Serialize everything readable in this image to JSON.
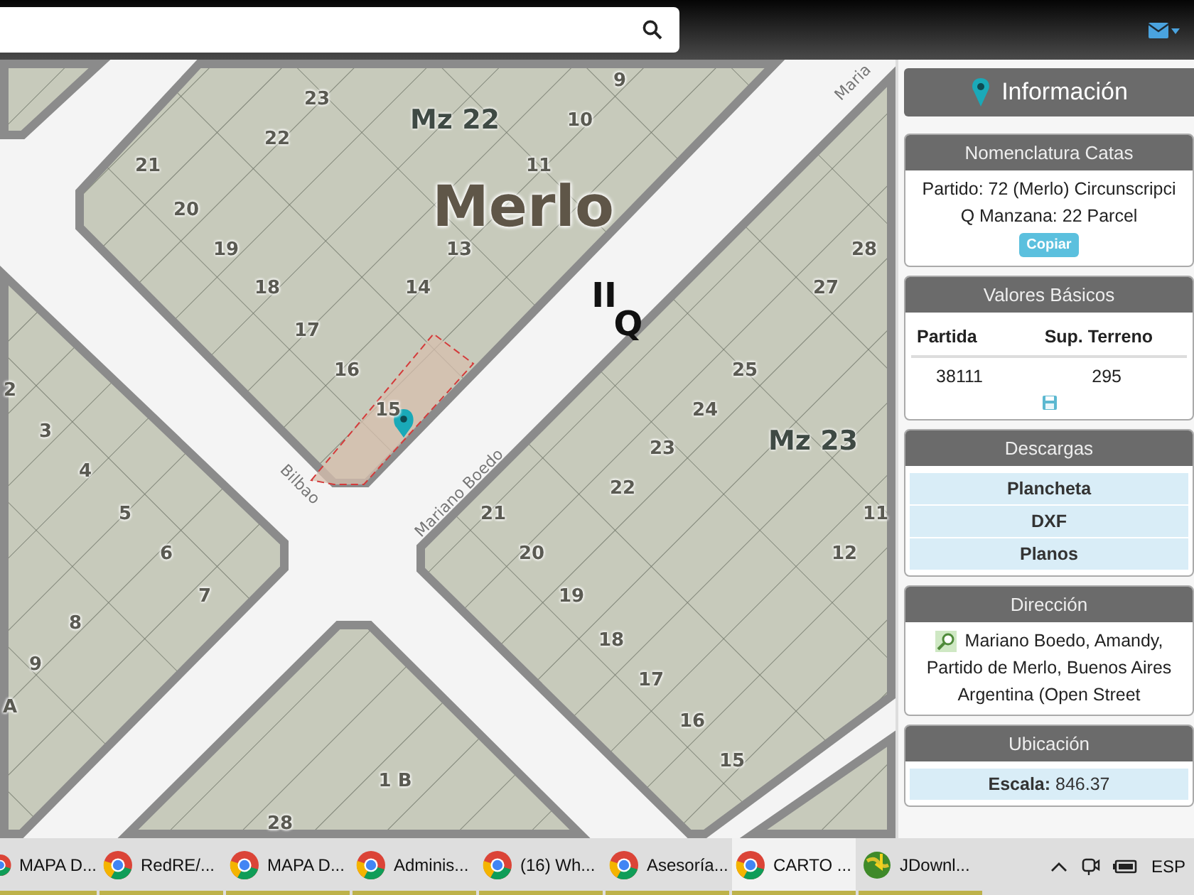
{
  "map": {
    "block_labels": [
      {
        "kind": "street",
        "text": "Maria"
      },
      {
        "kind": "block",
        "text": "Mz 22"
      },
      {
        "kind": "locality",
        "text": "Merlo"
      },
      {
        "kind": "section",
        "text": "II"
      },
      {
        "kind": "section",
        "text": "Q"
      },
      {
        "kind": "block",
        "text": "Mz 23"
      },
      {
        "kind": "street",
        "text": "Bilbao"
      },
      {
        "kind": "street",
        "text": "Mariano Boedo"
      }
    ],
    "lot_numbers": [
      "9",
      "23",
      "10",
      "22",
      "21",
      "11",
      "20",
      "19",
      "13",
      "28",
      "18",
      "14",
      "27",
      "17",
      "16",
      "25",
      "2",
      "15",
      "24",
      "3",
      "23",
      "4",
      "22",
      "5",
      "21",
      "11",
      "6",
      "20",
      "12",
      "7",
      "19",
      "8",
      "18",
      "9",
      "17",
      "A",
      "16",
      "15",
      "1 B",
      "28"
    ]
  },
  "panel": {
    "title": "Información",
    "nomenclatura": {
      "header": "Nomenclatura Catas",
      "lines": [
        "Partido: 72 (Merlo) Circunscripci",
        "Q Manzana: 22 Parcel"
      ],
      "button": "Copiar"
    },
    "valores": {
      "header": "Valores Básicos",
      "columns": [
        "Partida",
        "Sup. Terreno"
      ],
      "row": [
        "38111",
        "295"
      ]
    },
    "descargas": {
      "header": "Descargas",
      "items": [
        "Plancheta",
        "DXF",
        "Planos"
      ]
    },
    "direccion": {
      "header": "Dirección",
      "lines": [
        "Mariano Boedo, Amandy,",
        "Partido de Merlo, Buenos Aires",
        "Argentina (Open Street"
      ]
    },
    "ubicacion": {
      "header": "Ubicación",
      "scale": "**Escala:** 846.37"
    }
  },
  "taskbar": {
    "items": [
      {
        "kind": "chrome",
        "label": "MAPA D...",
        "selected": false
      },
      {
        "kind": "chrome",
        "label": "RedRE/...",
        "selected": false
      },
      {
        "kind": "chrome",
        "label": "MAPA D...",
        "selected": false
      },
      {
        "kind": "chrome",
        "label": "Adminis...",
        "selected": false
      },
      {
        "kind": "chrome",
        "label": "(16) Wh...",
        "selected": false
      },
      {
        "kind": "chrome",
        "label": "Asesoría...",
        "selected": false
      },
      {
        "kind": "chrome",
        "label": "CARTO ...",
        "selected": true
      },
      {
        "kind": "jdownloader",
        "label": "JDownl...",
        "selected": false
      }
    ],
    "language": "ESP"
  }
}
